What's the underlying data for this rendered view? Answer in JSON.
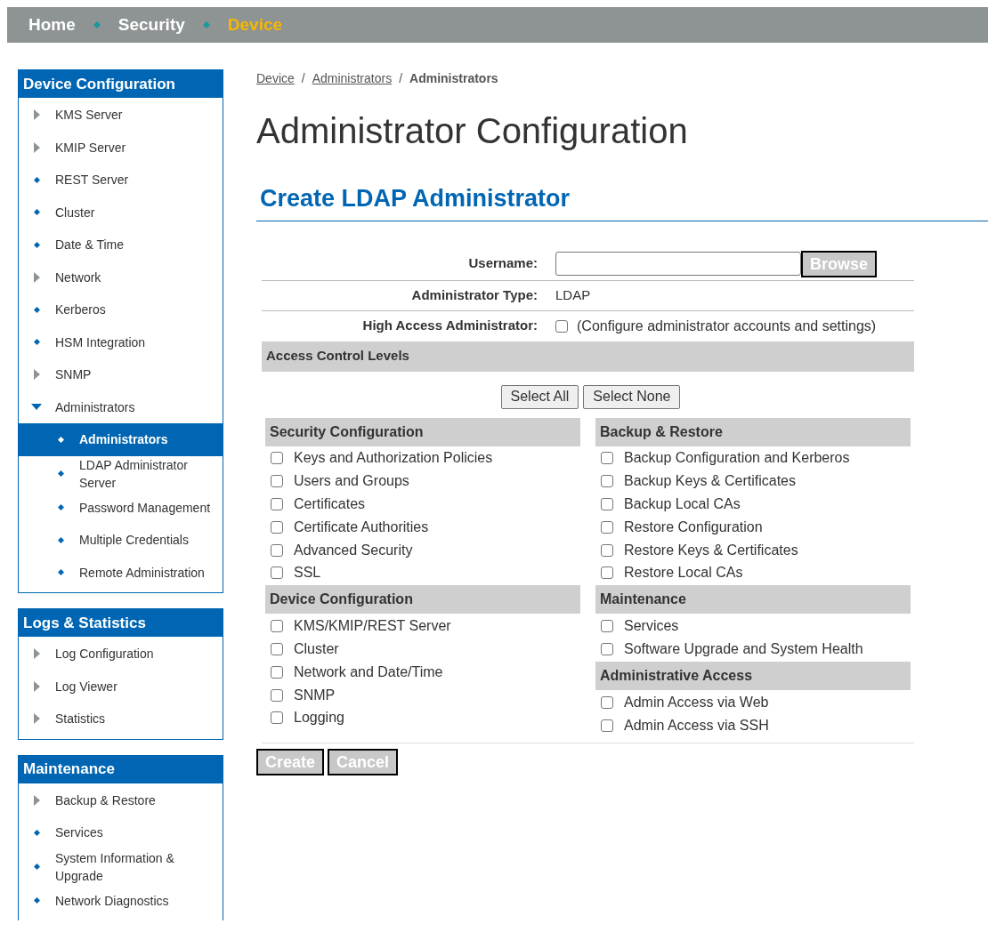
{
  "top_nav": [
    {
      "label": "Home",
      "selected": false
    },
    {
      "label": "Security",
      "selected": false
    },
    {
      "label": "Device",
      "selected": true
    }
  ],
  "sidebar": [
    {
      "title": "Device Configuration",
      "items": [
        {
          "label": "KMS Server",
          "kind": "folder",
          "expanded": false,
          "selected": false
        },
        {
          "label": "KMIP Server",
          "kind": "folder",
          "expanded": false,
          "selected": false
        },
        {
          "label": "REST Server",
          "kind": "page",
          "selected": false
        },
        {
          "label": "Cluster",
          "kind": "page",
          "selected": false
        },
        {
          "label": "Date & Time",
          "kind": "page",
          "selected": false
        },
        {
          "label": "Network",
          "kind": "folder",
          "expanded": false,
          "selected": false
        },
        {
          "label": "Kerberos",
          "kind": "page",
          "selected": false
        },
        {
          "label": "HSM Integration",
          "kind": "page",
          "selected": false
        },
        {
          "label": "SNMP",
          "kind": "folder",
          "expanded": false,
          "selected": false
        },
        {
          "label": "Administrators",
          "kind": "folder",
          "expanded": true,
          "selected": false,
          "children": [
            {
              "label": "Administrators",
              "kind": "page",
              "selected": true
            },
            {
              "label": "LDAP Administrator Server",
              "kind": "page",
              "selected": false
            },
            {
              "label": "Password Management",
              "kind": "page",
              "selected": false
            },
            {
              "label": "Multiple Credentials",
              "kind": "page",
              "selected": false
            },
            {
              "label": "Remote Administration",
              "kind": "page",
              "selected": false
            }
          ]
        }
      ]
    },
    {
      "title": "Logs & Statistics",
      "items": [
        {
          "label": "Log Configuration",
          "kind": "folder",
          "expanded": false,
          "selected": false
        },
        {
          "label": "Log Viewer",
          "kind": "folder",
          "expanded": false,
          "selected": false
        },
        {
          "label": "Statistics",
          "kind": "folder",
          "expanded": false,
          "selected": false
        }
      ]
    },
    {
      "title": "Maintenance",
      "items": [
        {
          "label": "Backup & Restore",
          "kind": "folder",
          "expanded": false,
          "selected": false
        },
        {
          "label": "Services",
          "kind": "page",
          "selected": false
        },
        {
          "label": "System Information & Upgrade",
          "kind": "page",
          "selected": false
        },
        {
          "label": "Network Diagnostics",
          "kind": "page",
          "selected": false
        }
      ]
    }
  ],
  "breadcrumb": [
    {
      "label": "Device",
      "kind": "link"
    },
    {
      "label": "/",
      "kind": "separator"
    },
    {
      "label": "Administrators",
      "kind": "link"
    },
    {
      "label": "/",
      "kind": "separator"
    },
    {
      "label": "Administrators",
      "kind": "current"
    }
  ],
  "page_title": "Administrator Configuration",
  "section_title": "Create LDAP Administrator",
  "form": {
    "username": {
      "label": "Username:",
      "button": "Browse"
    },
    "admin_type": {
      "label": "Administrator Type:",
      "value": "LDAP"
    },
    "high_access": {
      "label": "High Access Administrator:",
      "checked": false,
      "note": "(Configure administrator accounts and settings)"
    },
    "access_title": "Access Control Levels",
    "select_buttons": [
      "Select All",
      "Select None"
    ],
    "columns": [
      [
        {
          "title": "Security Configuration",
          "options": [
            {
              "label": "Keys and Authorization Policies",
              "checked": false
            },
            {
              "label": "Users and Groups",
              "checked": false
            },
            {
              "label": "Certificates",
              "checked": false
            },
            {
              "label": "Certificate Authorities",
              "checked": false
            },
            {
              "label": "Advanced Security",
              "checked": false
            },
            {
              "label": "SSL",
              "checked": false
            }
          ]
        },
        {
          "title": "Device Configuration",
          "options": [
            {
              "label": "KMS/KMIP/REST Server",
              "checked": false
            },
            {
              "label": "Cluster",
              "checked": false
            },
            {
              "label": "Network and Date/Time",
              "checked": false
            },
            {
              "label": "SNMP",
              "checked": false
            },
            {
              "label": "Logging",
              "checked": false
            }
          ]
        }
      ],
      [
        {
          "title": "Backup & Restore",
          "options": [
            {
              "label": "Backup Configuration and Kerberos",
              "checked": false
            },
            {
              "label": "Backup Keys & Certificates",
              "checked": false
            },
            {
              "label": "Backup Local CAs",
              "checked": false
            },
            {
              "label": "Restore Configuration",
              "checked": false
            },
            {
              "label": "Restore Keys & Certificates",
              "checked": false
            },
            {
              "label": "Restore Local CAs",
              "checked": false
            }
          ]
        },
        {
          "title": "Maintenance",
          "options": [
            {
              "label": "Services",
              "checked": false
            },
            {
              "label": "Software Upgrade and System Health",
              "checked": false
            }
          ]
        },
        {
          "title": "Administrative Access",
          "options": [
            {
              "label": "Admin Access via Web",
              "checked": false
            },
            {
              "label": "Admin Access via SSH",
              "checked": false
            }
          ]
        }
      ]
    ],
    "actions": [
      "Create",
      "Cancel"
    ]
  }
}
